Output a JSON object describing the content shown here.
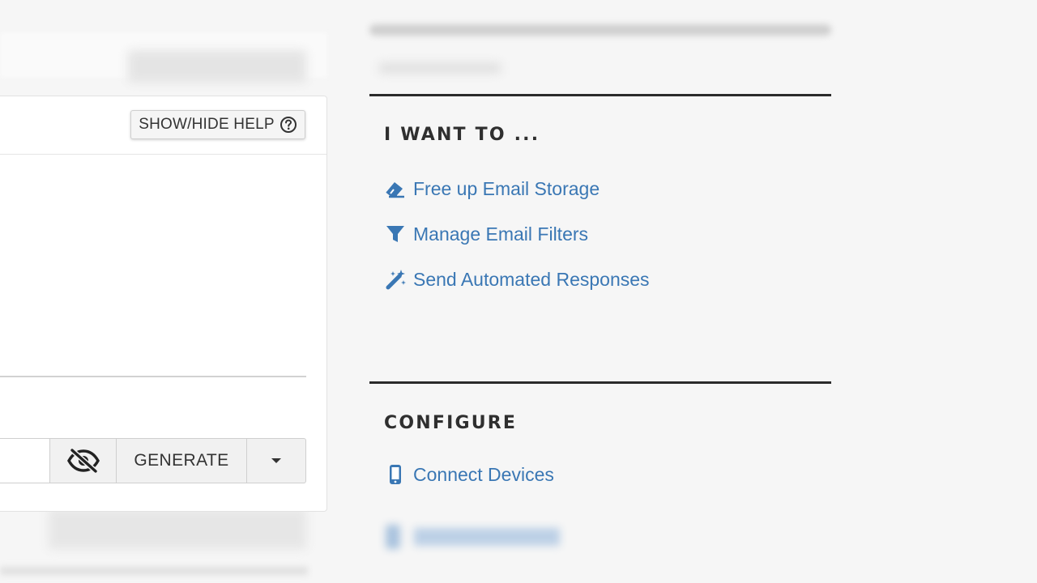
{
  "left_panel": {
    "help_button_label": "SHOW/HIDE HELP",
    "password_group": {
      "input_value": "",
      "generate_label": "GENERATE"
    }
  },
  "sidebar": {
    "i_want_to": {
      "title": "I WANT TO ...",
      "links": [
        {
          "label": "Free up Email Storage",
          "icon": "eraser-icon"
        },
        {
          "label": "Manage Email Filters",
          "icon": "filter-icon"
        },
        {
          "label": "Send Automated Responses",
          "icon": "magic-wand-icon"
        }
      ]
    },
    "configure": {
      "title": "CONFIGURE",
      "links": [
        {
          "label": "Connect Devices",
          "icon": "mobile-device-icon"
        }
      ]
    }
  },
  "colors": {
    "link": "#3a77b4",
    "heading": "#2f2f2f",
    "background": "#f6f6f6"
  }
}
